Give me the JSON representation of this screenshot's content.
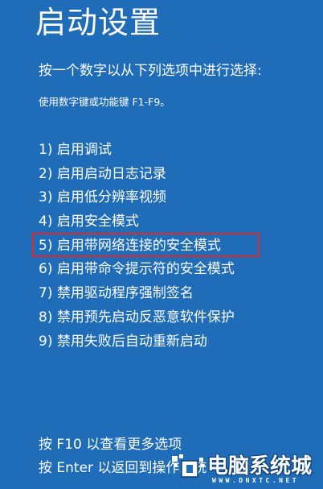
{
  "header": {
    "title": "启动设置"
  },
  "instructions": {
    "main": "按一个数字以从下列选项中进行选择:",
    "hint": "使用数字键或功能键 F1-F9。"
  },
  "options": [
    {
      "label": "1) 启用调试"
    },
    {
      "label": "2) 启用启动日志记录"
    },
    {
      "label": "3) 启用低分辨率视频"
    },
    {
      "label": "4) 启用安全模式"
    },
    {
      "label": "5) 启用带网络连接的安全模式",
      "highlighted": true
    },
    {
      "label": "6) 启用带命令提示符的安全模式"
    },
    {
      "label": "7) 禁用驱动程序强制签名"
    },
    {
      "label": "8) 禁用预先启动反恶意软件保护"
    },
    {
      "label": "9) 禁用失败后自动重新启动"
    }
  ],
  "footer": {
    "more_options": "按 F10 以查看更多选项",
    "return": "按 Enter 以返回到操作系统"
  },
  "watermark": {
    "brand": "电脑系统城",
    "url": "WWW.DNXTC.NET",
    "icon": "dnxtc-logo-icon"
  },
  "colors": {
    "background": "#1f6cb8",
    "text": "#ffffff",
    "highlight_border": "#e02b2b"
  }
}
